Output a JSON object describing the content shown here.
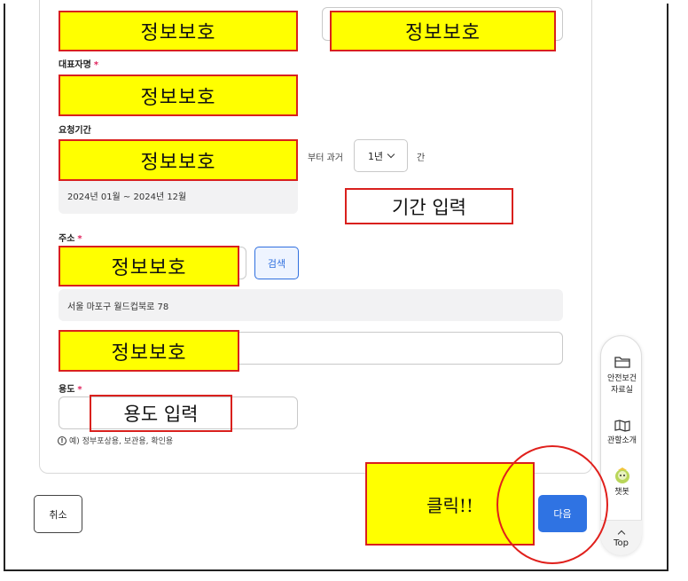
{
  "fields": {
    "representative_label": "대표자명",
    "period_label": "요청기간",
    "address_label": "주소",
    "purpose_label": "용도",
    "required_mark": "*"
  },
  "period": {
    "from_text": "부터 과거",
    "select_value": "1년",
    "suffix": "간",
    "range_text": "2024년 01월 ~ 2024년 12월"
  },
  "address": {
    "search_label": "검색",
    "value": "서울 마포구 월드컵북로 78"
  },
  "purpose": {
    "hint": "예) 정부포상용, 보관용, 확인용"
  },
  "buttons": {
    "cancel_label": "취소",
    "next_label": "다음"
  },
  "annotations": {
    "mask_text": "정보보호",
    "period_input": "기간 입력",
    "purpose_input": "용도 입력",
    "click": "클릭!!"
  },
  "floating_menu": {
    "items": [
      {
        "label": "안전보건\n자료실",
        "icon": "folder-icon"
      },
      {
        "label": "관할소개",
        "icon": "map-icon"
      },
      {
        "label": "챗봇",
        "icon": "chatbot-icon"
      }
    ],
    "top_label": "Top"
  },
  "colors": {
    "mask_fill": "#ffff00",
    "annotation_border": "#d9201d",
    "primary": "#2f73e3"
  }
}
